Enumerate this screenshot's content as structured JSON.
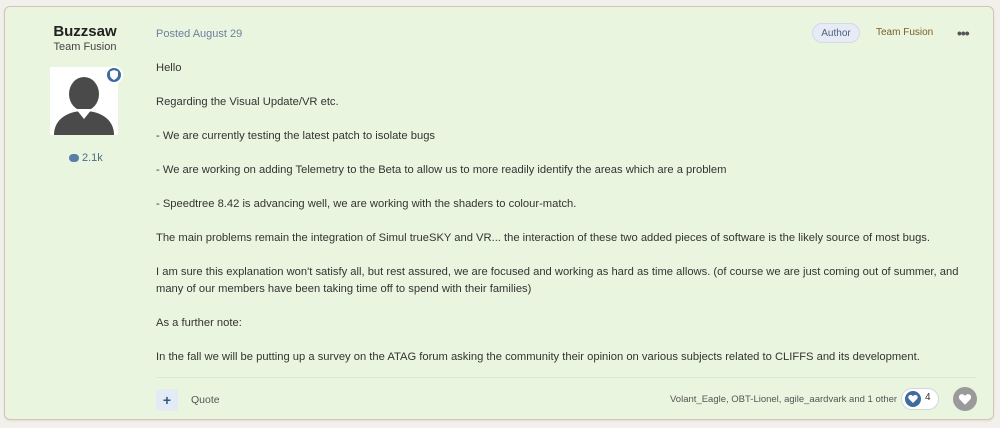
{
  "author": {
    "name": "Buzzsaw",
    "group": "Team Fusion",
    "post_count": "2.1k"
  },
  "header": {
    "posted": "Posted August 29",
    "author_badge": "Author",
    "team_label": "Team Fusion",
    "more": "•••"
  },
  "content": {
    "paragraphs": [
      "Hello",
      "Regarding the Visual Update/VR etc.",
      "-  We are currently testing the latest patch to isolate bugs",
      "-  We are working on adding Telemetry to the Beta to allow us to more readily identify the areas which are a problem",
      "-  Speedtree 8.42 is advancing well, we are working with the shaders to colour-match.",
      "The main problems remain the integration of Simul trueSKY and VR... the interaction of these two added pieces of software is the likely source of most bugs.",
      "I am sure this explanation won't satisfy all, but rest assured, we are focused and working as hard as time allows.  (of course we are just coming out of summer, and many of our members have been taking time off to spend with their families)",
      "As a further note:",
      "In the fall we will be putting up a survey on the ATAG forum asking the community their opinion on various subjects related to CLIFFS and its development."
    ]
  },
  "footer": {
    "plus": "+",
    "quote": "Quote",
    "reactors": "Volant_Eagle, OBT-Lionel, agile_aardvark and 1 other",
    "reaction_count": "4"
  },
  "colors": {
    "post_bg": "#eaf5df",
    "accent": "#3f6c9a"
  }
}
